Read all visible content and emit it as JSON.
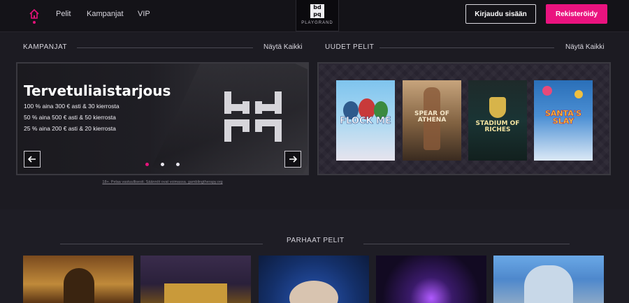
{
  "header": {
    "nav": [
      "Pelit",
      "Kampanjat",
      "VIP"
    ],
    "logo_text": "PLAYGRAND",
    "login_label": "Kirjaudu sisään",
    "register_label": "Rekisteröidy"
  },
  "campaigns": {
    "title": "KAMPANJAT",
    "show_all": "Näytä Kaikki",
    "promo": {
      "title": "Tervetuliaistarjous",
      "lines": [
        "100 % aina 300 € asti & 30 kierrosta",
        "50 % aina 500 € asti & 50 kierrosta",
        "25 % aina 200 € asti & 20 kierrosta"
      ],
      "disclaimer": "18+. Pelaa vastuullisesti. Säännöt ovat voimassa. gamblingtherapy.org",
      "slides": 3,
      "active_slide": 1
    }
  },
  "new_games": {
    "title": "UUDET PELIT",
    "show_all": "Näytä Kaikki",
    "games": [
      {
        "name": "FLOCK ME"
      },
      {
        "name": "SPEAR OF ATHENA"
      },
      {
        "name": "STADIUM OF RICHES"
      },
      {
        "name": "SANTA'S SLAY"
      }
    ]
  },
  "best_games": {
    "title": "PARHAAT PELIT"
  },
  "colors": {
    "accent": "#ea137f",
    "background": "#1c1b22",
    "header": "#141318"
  }
}
